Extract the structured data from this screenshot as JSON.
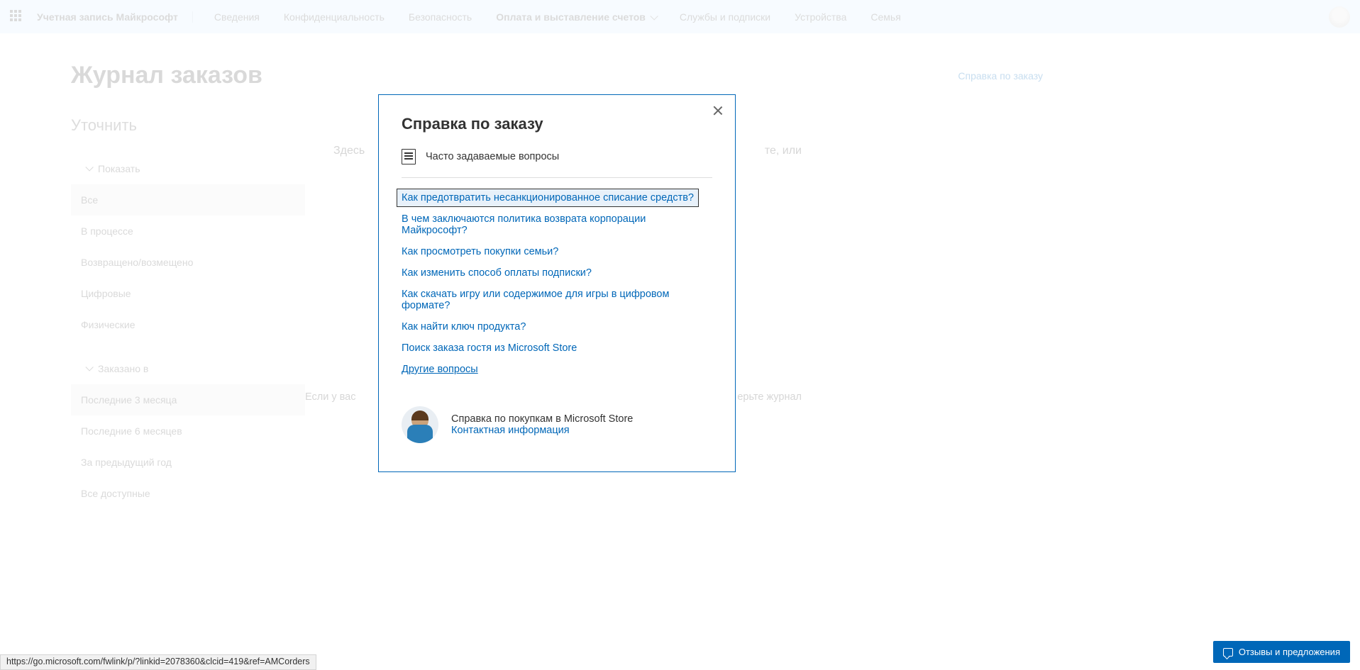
{
  "topbar": {
    "brand": "Учетная запись Майкрософт",
    "nav": [
      "Сведения",
      "Конфиденциальность",
      "Безопасность",
      "Оплата и выставление счетов",
      "Службы и подписки",
      "Устройства",
      "Семья"
    ]
  },
  "page": {
    "title": "Журнал заказов",
    "help_link": "Справка по заказу",
    "refine": "Уточнить",
    "group_show": "Показать",
    "show_opts": [
      "Все",
      "В процессе",
      "Возвращено/возмещено",
      "Цифровые",
      "Физические"
    ],
    "group_ordered": "Заказано в",
    "ordered_opts": [
      "Последние 3 месяца",
      "Последние 6 месяцев",
      "За предыдущий год",
      "Все доступные"
    ],
    "main_line1_a": "Здесь",
    "main_line1_b": "те, или",
    "main_line2_a": "Если у вас",
    "main_line2_b": "ерьте журнал"
  },
  "modal": {
    "title": "Справка по заказу",
    "faq_label": "Часто задаваемые вопросы",
    "links": [
      "Как предотвратить несанкционированное списание средств?",
      "В чем заключаются политика возврата корпорации Майкрософт?",
      "Как просмотреть покупки семьи?",
      "Как изменить способ оплаты подписки?",
      "Как скачать игру или содержимое для игры в цифровом формате?",
      "Как найти ключ продукта?",
      "Поиск заказа гостя из Microsoft Store"
    ],
    "more": "Другие вопросы",
    "store_title": "Справка по покупкам в Microsoft Store",
    "store_contact": "Контактная информация"
  },
  "status_url": "https://go.microsoft.com/fwlink/p/?linkid=2078360&clcid=419&ref=AMCorders",
  "feedback": "Отзывы и предложения"
}
